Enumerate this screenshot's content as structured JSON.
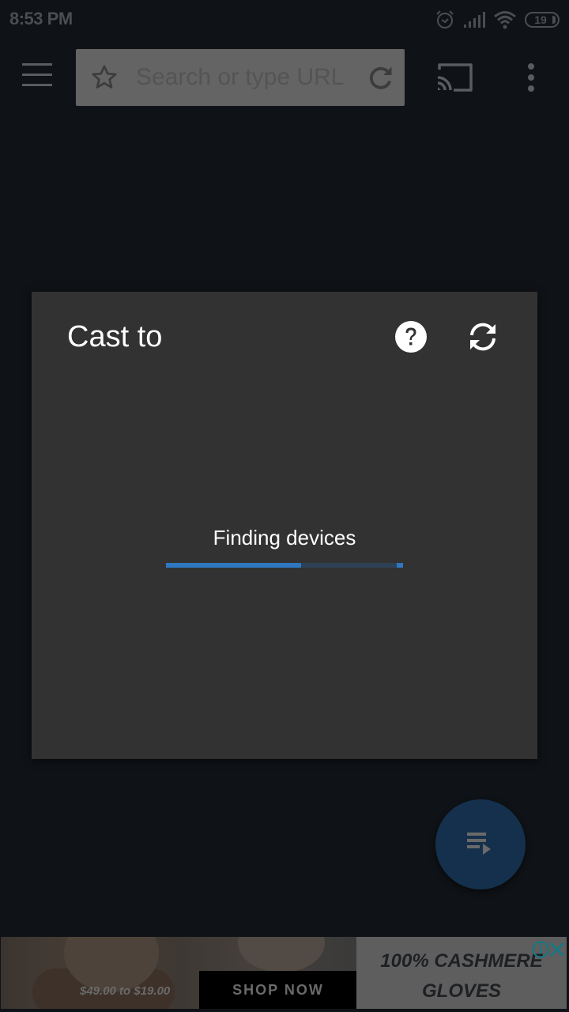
{
  "status_bar": {
    "time": "8:53 PM",
    "icons": [
      "alarm-icon",
      "signal-icon",
      "wifi-icon",
      "battery-icon"
    ],
    "battery_level": "19"
  },
  "toolbar": {
    "menu_icon": "hamburger-menu-icon",
    "url_placeholder": "Search or type URL",
    "url_value": "",
    "bookmark_icon": "star-icon",
    "reload_icon": "reload-icon",
    "cast_icon": "cast-icon",
    "more_icon": "more-vert-icon"
  },
  "dialog": {
    "title": "Cast to",
    "help_icon": "help-circle-icon",
    "refresh_icon": "refresh-icon",
    "status_text": "Finding devices",
    "progress_percent": 57,
    "accent_color": "#2f77c0"
  },
  "fab": {
    "icon": "playlist-play-icon",
    "color": "#14304c"
  },
  "ad": {
    "price_text": "$49.00 to $19.00",
    "cta_label": "SHOP NOW",
    "headline_line1": "100% CASHMERE",
    "headline_line2": "GLOVES",
    "info_icon": "ad-info-icon",
    "close_icon": "close-icon",
    "icon_color": "#0e7a87"
  }
}
